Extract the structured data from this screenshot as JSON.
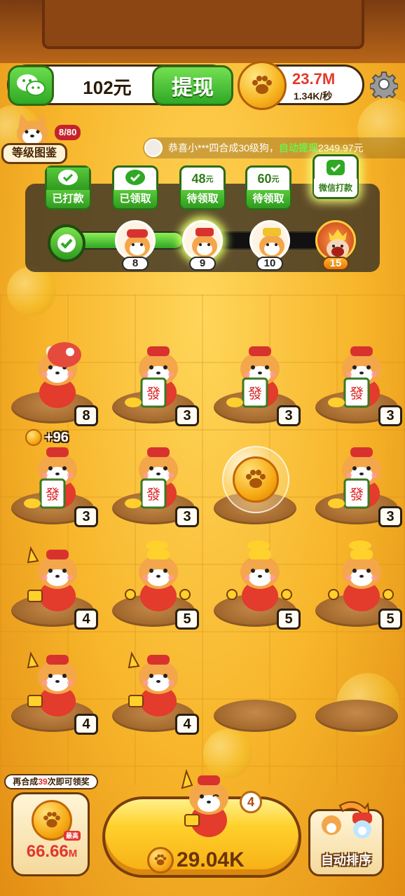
{
  "wallet": {
    "amount": "102元",
    "withdraw_label": "提现"
  },
  "coins": {
    "total": "23.7M",
    "rate": "1.34K/秒"
  },
  "encyclopedia": {
    "label": "等级图鉴",
    "progress": "8/80"
  },
  "ticker": {
    "prefix": "恭喜小***四合成30级狗，",
    "highlight": "自动提现",
    "amount": "2349.97元"
  },
  "rewards": [
    {
      "top": "",
      "bottom": "已打款",
      "state": "done"
    },
    {
      "top": "",
      "bottom": "已领取",
      "state": "done"
    },
    {
      "top": "48",
      "unit": "元",
      "bottom": "待领取",
      "state": "pending"
    },
    {
      "top": "60",
      "unit": "元",
      "bottom": "待领取",
      "state": "pending"
    },
    {
      "top": "",
      "bottom": "微信打款",
      "state": "highlight"
    }
  ],
  "level_track": {
    "levels": [
      "8",
      "9",
      "10",
      "15"
    ],
    "progress": 0.45
  },
  "grid": [
    [
      "8",
      "3",
      "3",
      "3"
    ],
    [
      "3",
      "3",
      "bubble",
      "3"
    ],
    [
      "4",
      "5",
      "5",
      "5"
    ],
    [
      "4",
      "4",
      "",
      ""
    ]
  ],
  "earn_float": "+96",
  "bottom": {
    "hint_prefix": "再合成",
    "hint_count": "39",
    "hint_suffix": "次即可领奖",
    "chest_tag": "最高",
    "chest_value": "66.66",
    "chest_unit": "M",
    "buy_price": "29.04K",
    "buy_count": "4",
    "sort_label": "自动排序"
  },
  "colors": {
    "accent_green": "#2fa924",
    "coin_gold": "#f7aa14",
    "red": "#e2372d"
  },
  "icons": [
    "wechat-icon",
    "paw-coin-icon",
    "gear-icon",
    "check-icon",
    "shiba-dog-icon",
    "lion-dance-icon"
  ]
}
